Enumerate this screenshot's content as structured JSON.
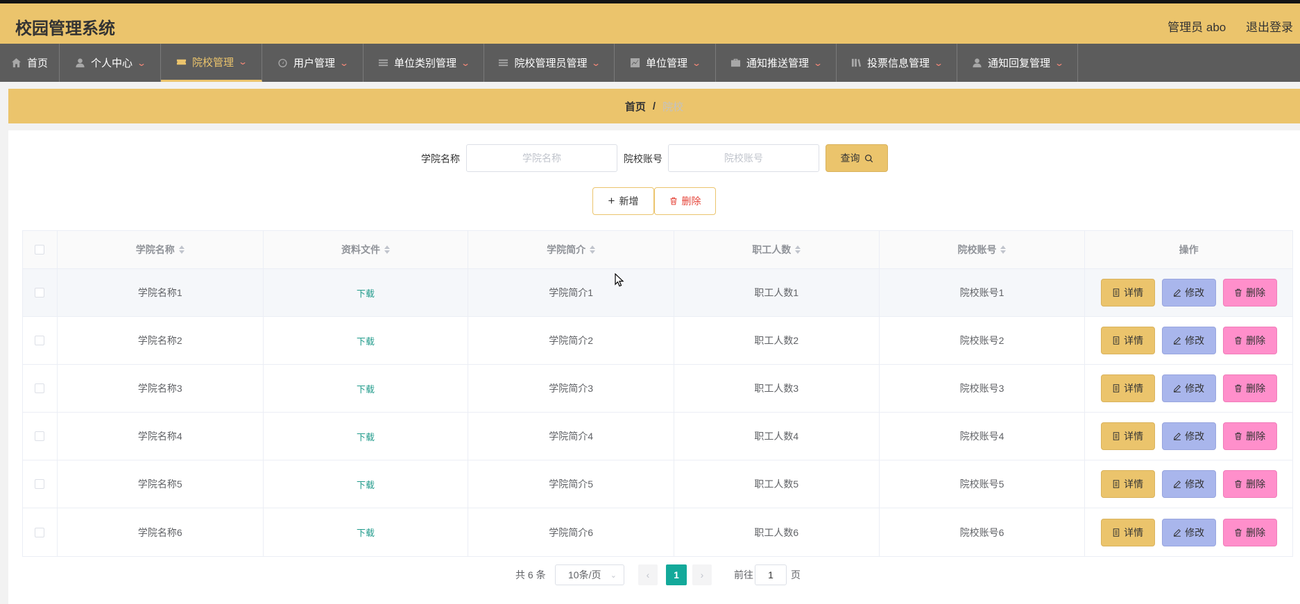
{
  "app": {
    "title": "校园管理系统",
    "user_label": "管理员 abo",
    "logout": "退出登录"
  },
  "nav": [
    {
      "label": "首页",
      "icon": "home-icon"
    },
    {
      "label": "个人中心",
      "icon": "user-icon"
    },
    {
      "label": "院校管理",
      "icon": "ticket-icon",
      "active": true
    },
    {
      "label": "用户管理",
      "icon": "dashboard-icon"
    },
    {
      "label": "单位类别管理",
      "icon": "list-icon"
    },
    {
      "label": "院校管理员管理",
      "icon": "list-icon"
    },
    {
      "label": "单位管理",
      "icon": "chart-icon"
    },
    {
      "label": "通知推送管理",
      "icon": "briefcase-icon"
    },
    {
      "label": "投票信息管理",
      "icon": "library-icon"
    },
    {
      "label": "通知回复管理",
      "icon": "user-icon"
    }
  ],
  "breadcrumb": {
    "home": "首页",
    "sep": "/",
    "current": "院校"
  },
  "search": {
    "name_label": "学院名称",
    "name_placeholder": "学院名称",
    "account_label": "院校账号",
    "account_placeholder": "院校账号",
    "query_label": "查询"
  },
  "actions": {
    "add": "新增",
    "delete": "删除"
  },
  "table": {
    "columns": [
      "学院名称",
      "资料文件",
      "学院简介",
      "职工人数",
      "院校账号",
      "操作"
    ],
    "rows": [
      {
        "name": "学院名称1",
        "file": "下载",
        "intro": "学院简介1",
        "staff": "职工人数1",
        "account": "院校账号1"
      },
      {
        "name": "学院名称2",
        "file": "下载",
        "intro": "学院简介2",
        "staff": "职工人数2",
        "account": "院校账号2"
      },
      {
        "name": "学院名称3",
        "file": "下载",
        "intro": "学院简介3",
        "staff": "职工人数3",
        "account": "院校账号3"
      },
      {
        "name": "学院名称4",
        "file": "下载",
        "intro": "学院简介4",
        "staff": "职工人数4",
        "account": "院校账号4"
      },
      {
        "name": "学院名称5",
        "file": "下载",
        "intro": "学院简介5",
        "staff": "职工人数5",
        "account": "院校账号5"
      },
      {
        "name": "学院名称6",
        "file": "下载",
        "intro": "学院简介6",
        "staff": "职工人数6",
        "account": "院校账号6"
      }
    ],
    "row_actions": {
      "detail": "详情",
      "edit": "修改",
      "delete": "删除"
    }
  },
  "pagination": {
    "total": "共 6 条",
    "page_size": "10条/页",
    "current_page": "1",
    "goto_label": "前往",
    "goto_value": "1",
    "page_suffix": "页"
  },
  "colors": {
    "accent": "#ebc46c",
    "nav_bg": "#5c5c5c",
    "edit": "#a9b6ec",
    "delete": "#ff8fcb",
    "page_active": "#13a99a"
  }
}
